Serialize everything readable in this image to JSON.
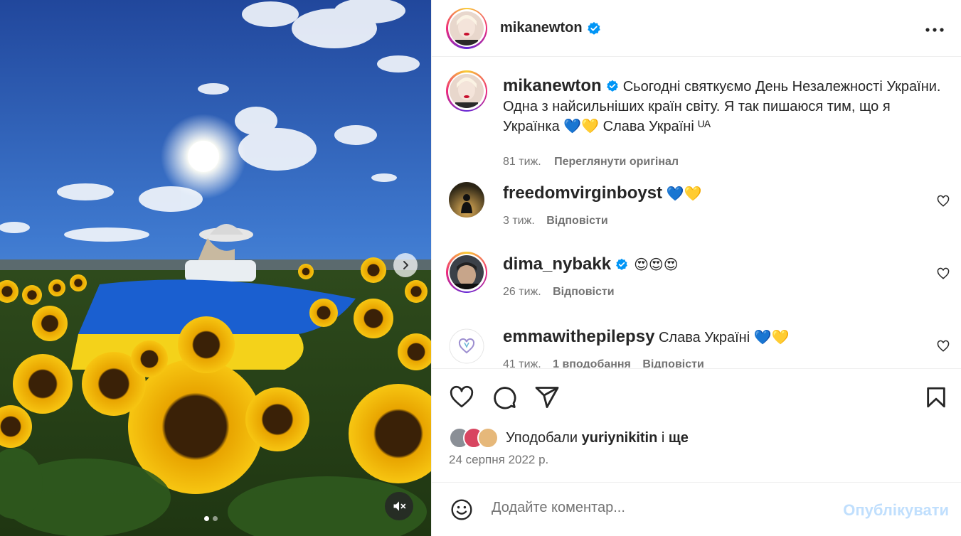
{
  "post": {
    "username": "mikanewton",
    "more_icon": "more-horizontal-icon"
  },
  "caption": {
    "username": "mikanewton",
    "text": "Сьогодні святкуємо День Незалежності України. Одна з найсильніших країн світу. Я так пишаюся тим, що я Українка 💙💛 Слава Україні ᵁᴬ",
    "time": "81 тиж.",
    "see_original": "Переглянути оригінал"
  },
  "comments": [
    {
      "username": "freedomvirginboyst",
      "text": "💙💛",
      "time": "3 тиж.",
      "reply": "Відповісти",
      "likes": ""
    },
    {
      "username": "dima_nybakk",
      "text": "😍😍😍",
      "time": "26 тиж.",
      "reply": "Відповісти",
      "likes": ""
    },
    {
      "username": "emmawithepilepsy",
      "text": "Слава Україні 💙💛",
      "time": "41 тиж.",
      "reply": "Відповісти",
      "likes": "1 вподобання"
    }
  ],
  "likes": {
    "prefix": "Уподобали",
    "user": "yuriynikitin",
    "middle": "і",
    "rest": "ще"
  },
  "date": "24 серпня 2022 р.",
  "add_comment": {
    "placeholder": "Додайте коментар...",
    "post_label": "Опублікувати"
  },
  "colors": {
    "verified": "#0095f6",
    "post_disabled": "#c0dffd",
    "muted_text": "#737373",
    "flag_blue": "#1a5fd0",
    "flag_yellow": "#f4d21a"
  }
}
